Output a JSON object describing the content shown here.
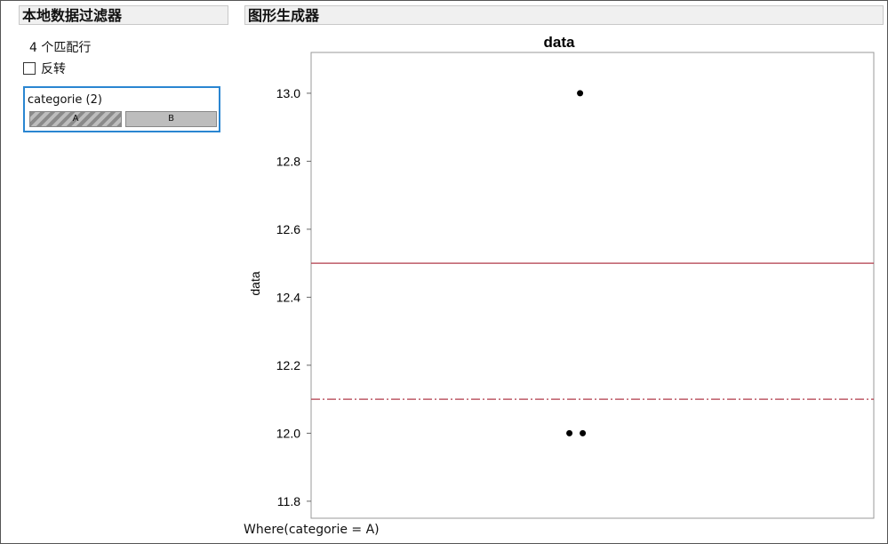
{
  "left_panel": {
    "title": "本地数据过滤器",
    "match_count": "4 个匹配行",
    "invert_label": "反转",
    "invert_checked": false,
    "filter": {
      "title": "categorie (2)",
      "levels": [
        {
          "label": "A",
          "selected": true
        },
        {
          "label": "B",
          "selected": false
        }
      ]
    }
  },
  "right_panel": {
    "title": "图形生成器",
    "where_clause": "Where(categorie = A)"
  },
  "colors": {
    "selection_border": "#2a86d1",
    "reference_line": "#b03a48",
    "point": "#000000"
  },
  "chart_data": {
    "type": "scatter",
    "title": "data",
    "xlabel": "",
    "ylabel": "data",
    "ylim": [
      11.75,
      13.12
    ],
    "yticks": [
      11.8,
      12.0,
      12.2,
      12.4,
      12.6,
      12.8,
      13.0
    ],
    "ytick_labels": [
      "11.8",
      "12.0",
      "12.2",
      "12.4",
      "12.6",
      "12.8",
      "13.0"
    ],
    "points": [
      {
        "x": 0.0,
        "y": 13.0
      },
      {
        "x": -0.04,
        "y": 12.0
      },
      {
        "x": 0.01,
        "y": 12.0
      }
    ],
    "reference_lines": [
      {
        "y": 12.5,
        "style": "solid"
      },
      {
        "y": 12.1,
        "style": "dash-dot"
      }
    ],
    "grid": false
  }
}
